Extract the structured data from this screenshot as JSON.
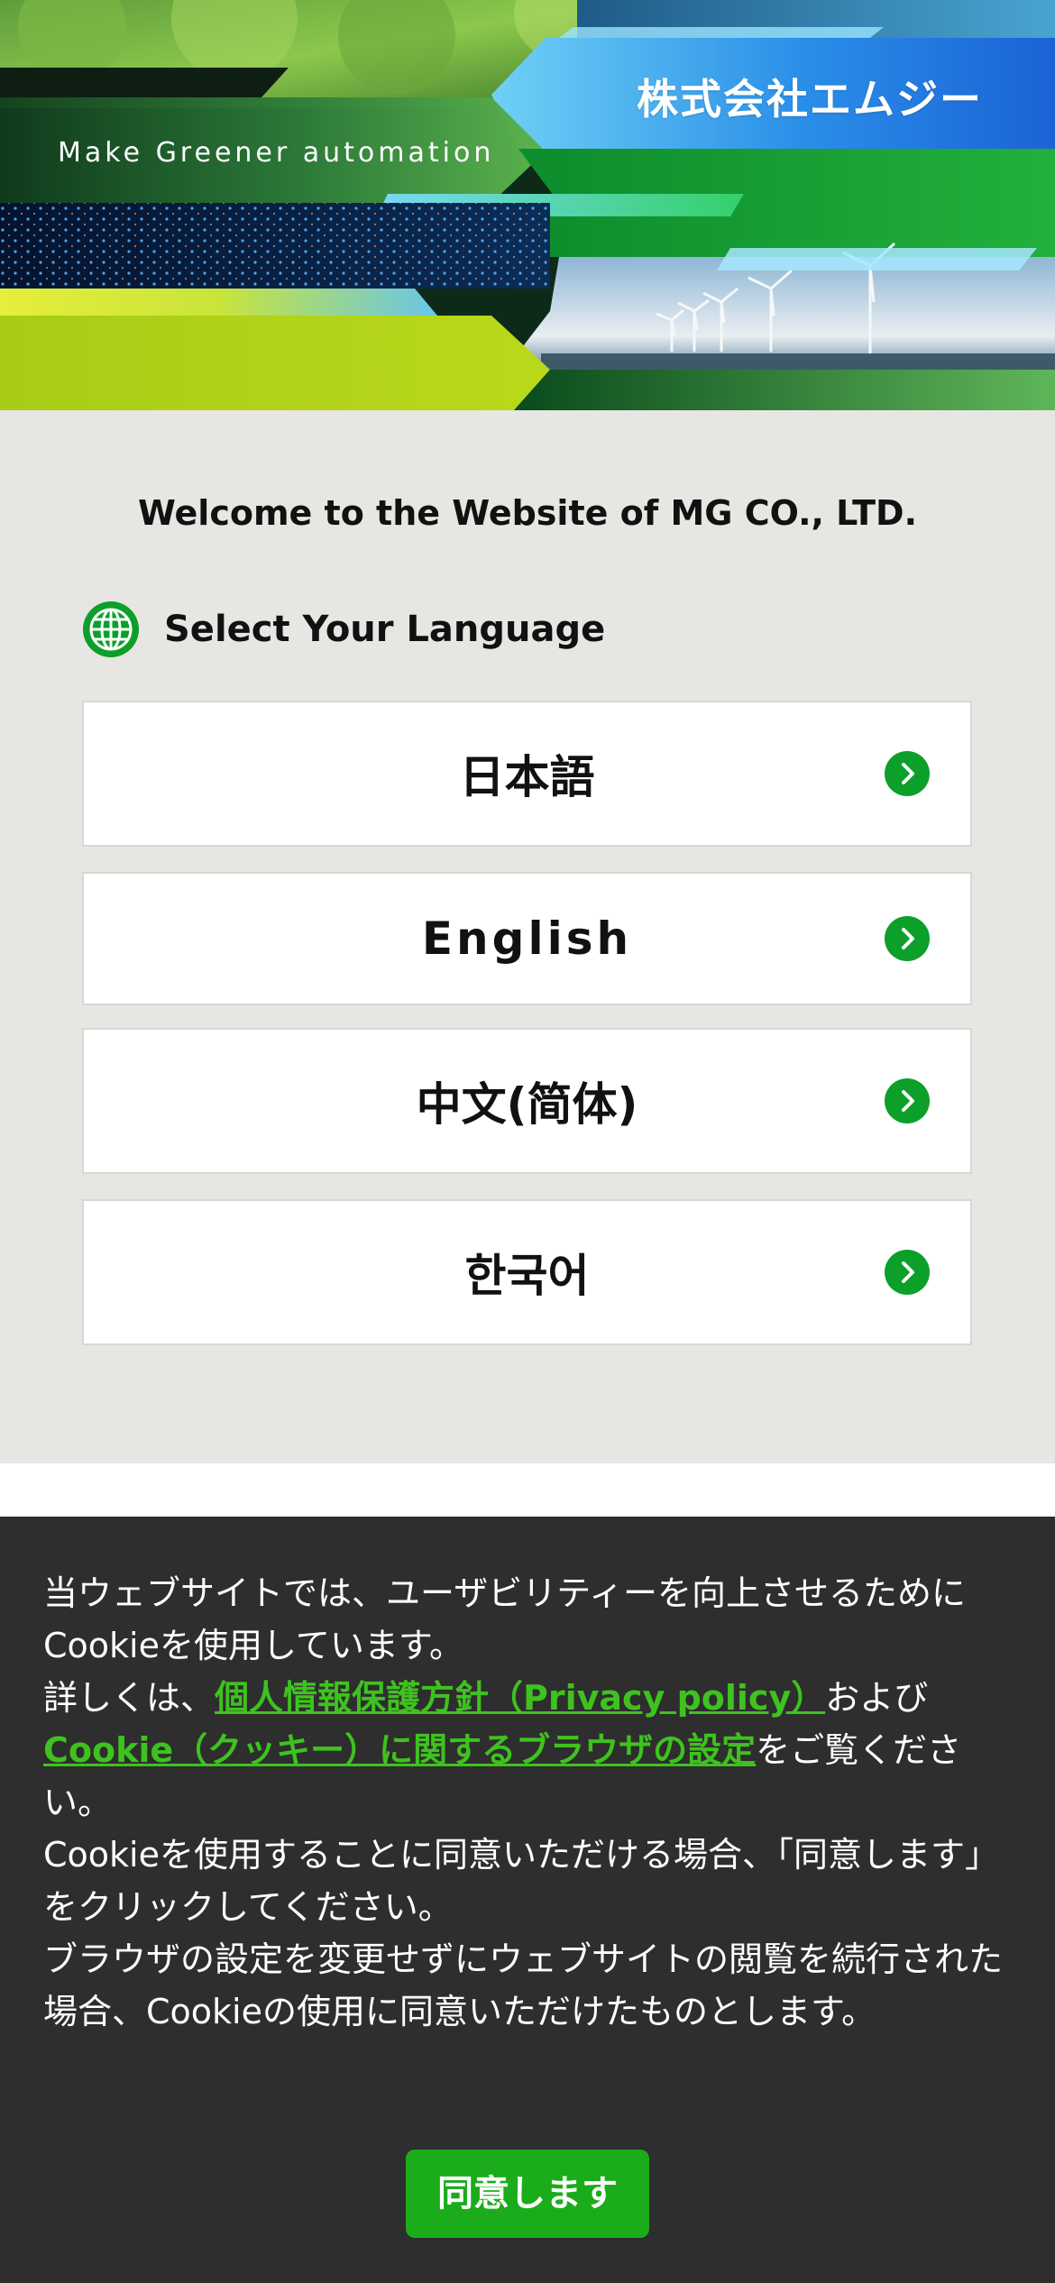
{
  "hero": {
    "company_name": "株式会社エムジー",
    "tagline": "Make Greener automation"
  },
  "welcome": "Welcome to the Website of MG CO., LTD.",
  "select_language": {
    "icon": "globe-icon",
    "label": "Select Your Language"
  },
  "languages": [
    {
      "label": "日本語",
      "icon": "chevron-right-icon"
    },
    {
      "label": "English",
      "icon": "chevron-right-icon"
    },
    {
      "label": "中文(简体)",
      "icon": "chevron-right-icon"
    },
    {
      "label": "한국어",
      "icon": "chevron-right-icon"
    }
  ],
  "cookie": {
    "line1": "当ウェブサイトでは、ユーザビリティーを向上させるためにCookieを使用しています。",
    "details_prefix": "詳しくは、",
    "privacy_link": "個人情報保護方針（Privacy policy）",
    "details_and": "および",
    "browser_link": "Cookie（クッキー）に関するブラウザの設定",
    "details_suffix": "をご覧ください。",
    "line3": "Cookieを使用することに同意いただける場合、「同意します」をクリックしてください。",
    "line4": "ブラウザの設定を変更せずにウェブサイトの閲覧を続行された場合、Cookieの使用に同意いただけたものとします。",
    "agree_button": "同意します"
  },
  "colors": {
    "accent_green": "#0c9f2a",
    "link_green": "#3ec21f",
    "button_green": "#1aac1a",
    "section_bg": "#e8e6e3",
    "banner_bg": "#2e2e2e"
  }
}
